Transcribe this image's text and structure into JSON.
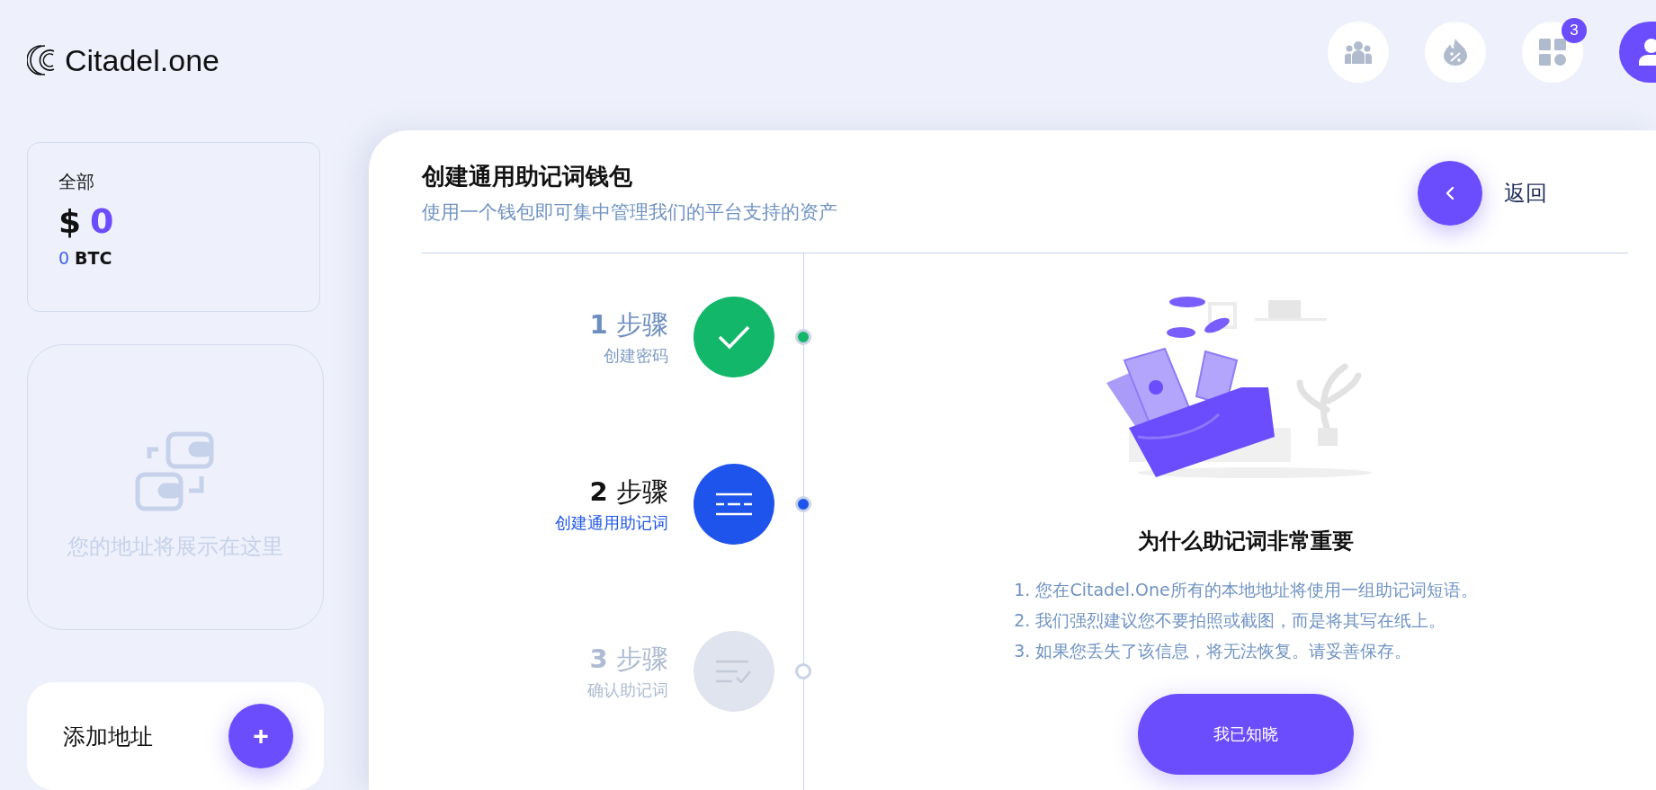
{
  "logo": {
    "text": "Citadel.one"
  },
  "toolbar": {
    "badge": "3"
  },
  "balance": {
    "label": "全部",
    "currency": "$",
    "amount": "0",
    "btc_amount": "0",
    "btc_unit": "BTC"
  },
  "addresses": {
    "empty_text": "您的地址将展示在这里"
  },
  "add_address": {
    "label": "添加地址",
    "button": "+"
  },
  "panel": {
    "title": "创建通用助记词钱包",
    "subtitle": "使用一个钱包即可集中管理我们的平台支持的资产",
    "back": "返回"
  },
  "steps": [
    {
      "title": "**1** 步骤",
      "subtitle": "创建密码",
      "kind": "done"
    },
    {
      "title": "**2** 步骤",
      "subtitle": "创建通用助记词",
      "kind": "current"
    },
    {
      "title": "**3** 步骤",
      "subtitle": "确认助记词",
      "kind": "pending"
    }
  ],
  "info": {
    "heading": "为什么助记词非常重要",
    "items": [
      "1. 您在Citadel.One所有的本地地址将使用一组助记词短语。",
      "2. 我们强烈建议您不要拍照或截图，而是将其写在纸上。",
      "3. 如果您丢失了该信息，将无法恢复。请妥善保存。"
    ],
    "button": "我已知晓"
  }
}
